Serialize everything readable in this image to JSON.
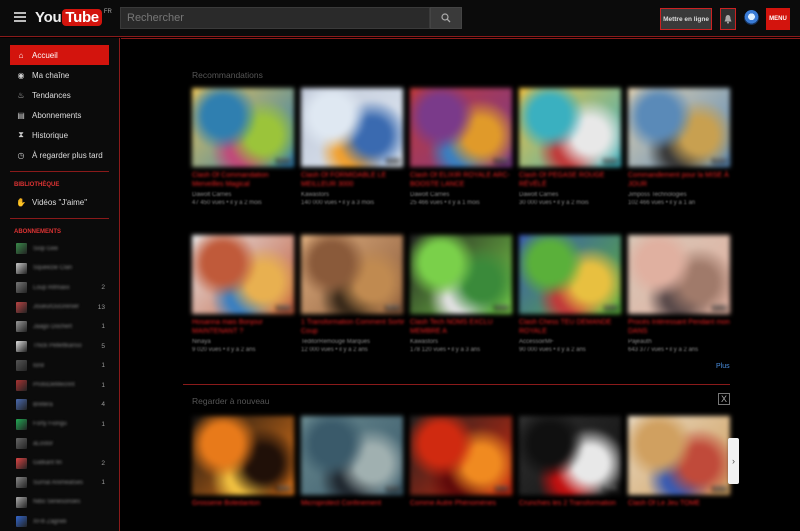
{
  "header": {
    "logo_you": "You",
    "logo_tube": "Tube",
    "logo_region": "FR",
    "search_placeholder": "Rechercher",
    "upload_label": "Mettre en ligne",
    "menu_label": "MENU"
  },
  "sidebar": {
    "nav": [
      {
        "label": "Accueil",
        "icon": "home-icon",
        "active": true
      },
      {
        "label": "Ma chaîne",
        "icon": "person-icon"
      },
      {
        "label": "Tendances",
        "icon": "flame-icon"
      },
      {
        "label": "Abonnements",
        "icon": "subscriptions-icon"
      },
      {
        "label": "Historique",
        "icon": "hourglass-icon"
      },
      {
        "label": "À regarder plus tard",
        "icon": "clock-icon"
      }
    ],
    "library_title": "BIBLIOTHÈQUE",
    "library_items": [
      {
        "label": "Vidéos \"J'aime\"",
        "icon": "thumbs-up-icon"
      }
    ],
    "subs_title": "ABONNEMENTS",
    "subscriptions": [
      {
        "name": "Siop Gee",
        "count": "",
        "color": "#3a8a4a"
      },
      {
        "name": "Squeezie Clan",
        "count": "",
        "color": "#c8c8c8"
      },
      {
        "name": "Loup Rifmaxx",
        "count": "2",
        "color": "#777"
      },
      {
        "name": "JoueurDuGrenier",
        "count": "13",
        "color": "#b44"
      },
      {
        "name": "Jaago Dochert",
        "count": "1",
        "color": "#999"
      },
      {
        "name": "Thick Pellettkanso",
        "count": "5",
        "color": "#ddd"
      },
      {
        "name": "Ionil",
        "count": "1",
        "color": "#555"
      },
      {
        "name": "ProtoDeMecrint",
        "count": "1",
        "color": "#a33"
      },
      {
        "name": "Brétéra",
        "count": "4",
        "color": "#4a6ab0"
      },
      {
        "name": "Forty Fiongu",
        "count": "1",
        "color": "#2a5"
      },
      {
        "name": "aLostor",
        "count": "",
        "color": "#666"
      },
      {
        "name": "Gatkant fin",
        "count": "2",
        "color": "#d44"
      },
      {
        "name": "Surnal Animeatses",
        "count": "1",
        "color": "#888"
      },
      {
        "name": "Nibo Senesonoes",
        "count": "",
        "color": "#aaa"
      },
      {
        "name": "XFifi Zagneli",
        "count": "",
        "color": "#36c"
      }
    ]
  },
  "main": {
    "recommendations_title": "Recommandations",
    "rewatch_title": "Regarder à nouveau",
    "more_label": "Plus",
    "close_label": "X",
    "next_label": "›",
    "row1": [
      {
        "title": "Clash Of Commandation Merveilles Magical",
        "channel": "Dawolt Carries",
        "meta": "47 450 vues • il y a 2 mois",
        "duration": "10:23",
        "colors": [
          "#2f7fb0",
          "#9bc43a",
          "#c04a7a",
          "#e8c35a"
        ]
      },
      {
        "title": "Clash Of FORMIDABLE LE MEILLEUR 3000",
        "channel": "Kawastors",
        "meta": "140 000 vues • il y a 3 mois",
        "duration": "14:11",
        "colors": [
          "#dfe8f2",
          "#3a6ab0",
          "#f0a030",
          "#c0c8d8"
        ]
      },
      {
        "title": "Clash Of ELIXIR ROYALE ARC-BOOSTE LANCE",
        "channel": "Dawolt Carries",
        "meta": "25 466 vues • il y a 1 mois",
        "duration": "12:45",
        "colors": [
          "#7a3a8a",
          "#e09a2a",
          "#3a7fc0",
          "#c03a3a"
        ]
      },
      {
        "title": "Clash Of PEGASE ROUGE RÉVÉLÉ",
        "channel": "Dawolt Carries",
        "meta": "30 000 vues • il y a 2 mois",
        "duration": "09:58",
        "colors": [
          "#3ab0c0",
          "#e8e8e8",
          "#c03a3a",
          "#f0c040"
        ]
      },
      {
        "title": "Commandement pour la MISE À JOUR",
        "channel": "Jimposs Technologies",
        "meta": "102 466 vues • il y a 1 an",
        "duration": "18:02",
        "colors": [
          "#5a8ab8",
          "#c8a050",
          "#3a3a3a",
          "#e0d0b0"
        ]
      }
    ],
    "row2": [
      {
        "title": "Hosanna mais Bonjour MAINTENANT ?",
        "channel": "Ninaya",
        "meta": "9 020 vues • il y a 2 ans",
        "duration": "10:45",
        "colors": [
          "#c05a3a",
          "#e8b050",
          "#3a7fc0",
          "#e8e8e8"
        ]
      },
      {
        "title": "1 Transformation Comment Sortir Coup",
        "channel": "TeditorRemouge Marques",
        "meta": "12 000 vues • il y a 2 ans",
        "duration": "08:30",
        "colors": [
          "#8a5a3a",
          "#c08a50",
          "#3a2a1a",
          "#e0b080"
        ]
      },
      {
        "title": "Clash Tech NOMS EXCLU MEMBRE A",
        "channel": "Kawastors",
        "meta": "178 120 vues • il y a 3 ans",
        "duration": "12:02",
        "colors": [
          "#7ad04a",
          "#3a8a3a",
          "#e0e0e0",
          "#202020"
        ]
      },
      {
        "title": "Clash Chess TEU DEMANDE ROYALE",
        "channel": "AccessoirMF",
        "meta": "90 000 vues • il y a 2 ans",
        "duration": "10:11",
        "colors": [
          "#5ab03a",
          "#e8c040",
          "#c03a3a",
          "#3a5ab0"
        ]
      },
      {
        "title": "Procès Intéressant Pendant mon DANS",
        "channel": "Pajeauth",
        "meta": "643 377 vues • il y a 2 ans",
        "duration": "07:14",
        "colors": [
          "#e0b0a0",
          "#a07a6a",
          "#5a4a4a",
          "#d8c8b8"
        ]
      }
    ],
    "row3": [
      {
        "title": "Grosserie Botedanton",
        "duration": "10:56",
        "colors": [
          "#e87a1a",
          "#201008",
          "#f0c040",
          "#101010"
        ]
      },
      {
        "title": "Microprotect Confinement",
        "duration": "14:11",
        "colors": [
          "#3a5a6a",
          "#a0b0b0",
          "#202830",
          "#6a8a90"
        ]
      },
      {
        "title": "Comme Autre Phénomènes",
        "duration": "11:12",
        "colors": [
          "#d02a10",
          "#f08a20",
          "#600a0a",
          "#202020"
        ]
      },
      {
        "title": "Crunchies les 2 Transformation",
        "duration": "09:40",
        "colors": [
          "#101010",
          "#e8e8e8",
          "#c01010",
          "#303030"
        ]
      },
      {
        "title": "Clash Of Le Jeu TOME",
        "duration": "15:20",
        "colors": [
          "#d0a060",
          "#c04a3a",
          "#3a5ab0",
          "#e8d8c0"
        ]
      }
    ]
  }
}
